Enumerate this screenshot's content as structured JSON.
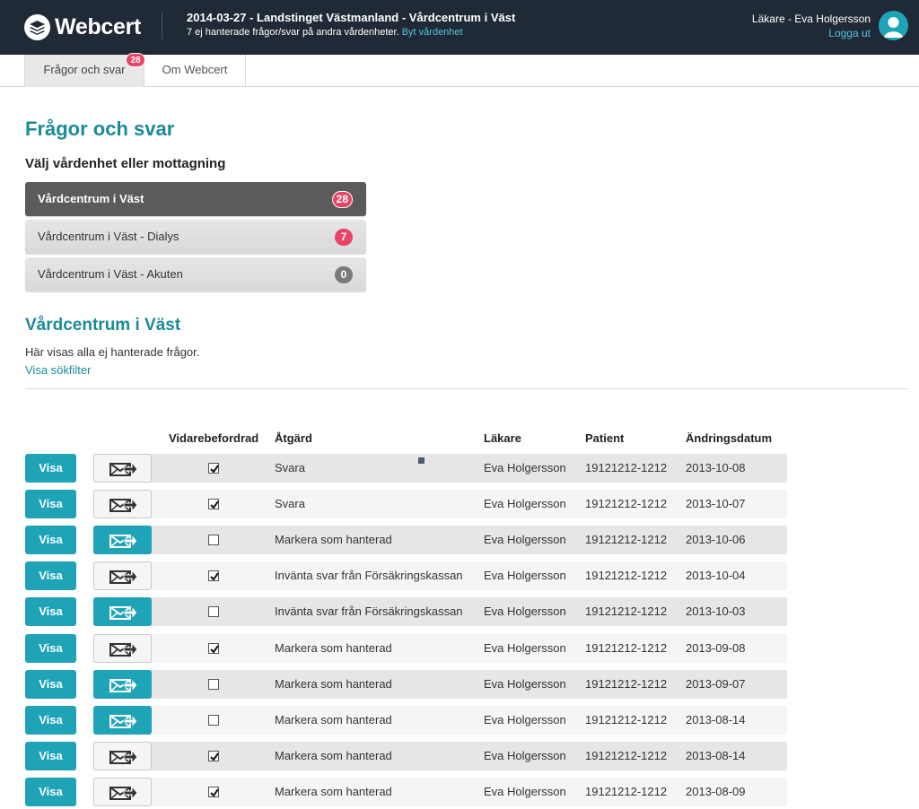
{
  "header": {
    "logo_text": "Webcert",
    "title": "2014-03-27 - Landstinget Västmanland - Vårdcentrum i Väst",
    "subtitle": "7 ej hanterade frågor/svar på andra vårdenheter.",
    "change_unit_link": "Byt vårdenhet",
    "user": "Läkare - Eva Holgersson",
    "logout": "Logga ut"
  },
  "tabs": [
    {
      "label": "Frågor och svar",
      "badge": "28"
    },
    {
      "label": "Om Webcert"
    }
  ],
  "page": {
    "title": "Frågor och svar",
    "choose_unit": "Välj vårdenhet eller mottagning",
    "units": [
      {
        "label": "Vårdcentrum i Väst",
        "count": "28"
      },
      {
        "label": "Vårdcentrum i Väst - Dialys",
        "count": "7"
      },
      {
        "label": "Vårdcentrum i Väst - Akuten",
        "count": "0"
      }
    ],
    "section_title": "Vårdcentrum i Väst",
    "description": "Här visas alla ej hanterade frågor.",
    "filter_link": "Visa sökfilter"
  },
  "table": {
    "headers": {
      "forwarded": "Vidarebefordrad",
      "action": "Åtgärd",
      "doctor": "Läkare",
      "patient": "Patient",
      "changed": "Ändringsdatum"
    },
    "view_label": "Visa",
    "rows": [
      {
        "forwarded": true,
        "fwd_active": false,
        "action": "Svara",
        "doctor": "Eva Holgersson",
        "patient": "19121212-1212",
        "date": "2013-10-08"
      },
      {
        "forwarded": true,
        "fwd_active": false,
        "action": "Svara",
        "doctor": "Eva Holgersson",
        "patient": "19121212-1212",
        "date": "2013-10-07"
      },
      {
        "forwarded": false,
        "fwd_active": true,
        "action": "Markera som hanterad",
        "doctor": "Eva Holgersson",
        "patient": "19121212-1212",
        "date": "2013-10-06"
      },
      {
        "forwarded": true,
        "fwd_active": false,
        "action": "Invänta svar från Försäkringskassan",
        "doctor": "Eva Holgersson",
        "patient": "19121212-1212",
        "date": "2013-10-04"
      },
      {
        "forwarded": false,
        "fwd_active": true,
        "action": "Invänta svar från Försäkringskassan",
        "doctor": "Eva Holgersson",
        "patient": "19121212-1212",
        "date": "2013-10-03"
      },
      {
        "forwarded": true,
        "fwd_active": false,
        "action": "Markera som hanterad",
        "doctor": "Eva Holgersson",
        "patient": "19121212-1212",
        "date": "2013-09-08"
      },
      {
        "forwarded": false,
        "fwd_active": true,
        "action": "Markera som hanterad",
        "doctor": "Eva Holgersson",
        "patient": "19121212-1212",
        "date": "2013-09-07"
      },
      {
        "forwarded": false,
        "fwd_active": true,
        "action": "Markera som hanterad",
        "doctor": "Eva Holgersson",
        "patient": "19121212-1212",
        "date": "2013-08-14"
      },
      {
        "forwarded": true,
        "fwd_active": false,
        "action": "Markera som hanterad",
        "doctor": "Eva Holgersson",
        "patient": "19121212-1212",
        "date": "2013-08-14"
      },
      {
        "forwarded": true,
        "fwd_active": false,
        "action": "Markera som hanterad",
        "doctor": "Eva Holgersson",
        "patient": "19121212-1212",
        "date": "2013-08-09"
      }
    ]
  },
  "colors": {
    "header_bg": "#202a36",
    "accent": "#1fa3b7",
    "title": "#1a8b99",
    "badge": "#e94466"
  },
  "icons": {
    "logo": "layers-icon",
    "avatar": "user-icon",
    "forward": "envelope-forward-icon",
    "checkbox": "check-icon"
  }
}
